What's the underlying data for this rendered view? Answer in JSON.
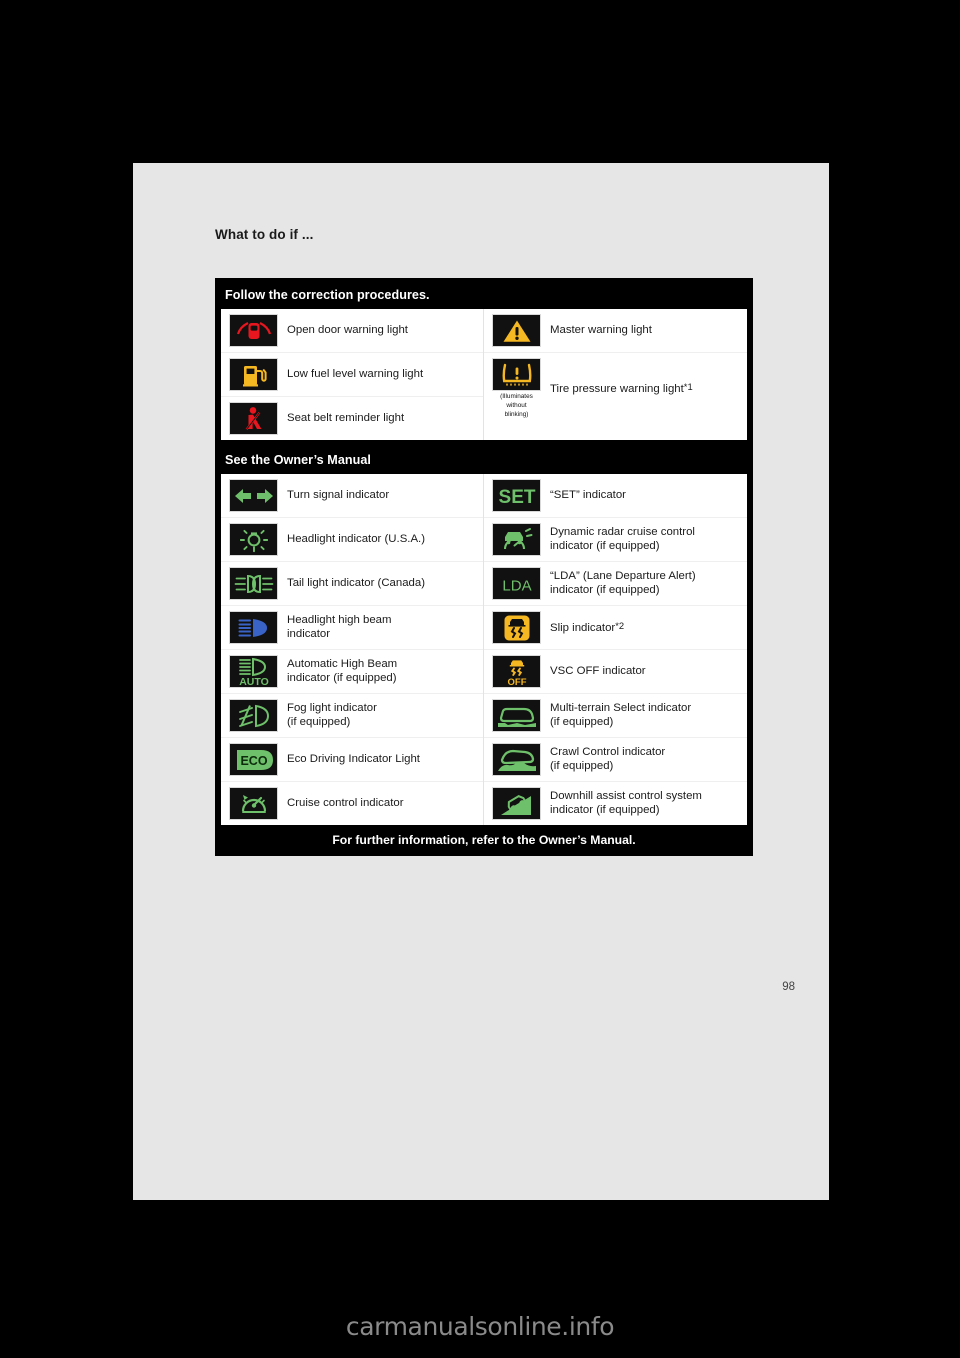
{
  "document": {
    "heading": "What to do if ...",
    "page_number": "98",
    "watermark": "carmanualsonline.info",
    "colors": {
      "page_bg": "#e6e6e6",
      "panel_bg": "#000000",
      "red": "#e8161f",
      "amber": "#f5b722",
      "green": "#6fc06a",
      "blue": "#3a63c8"
    }
  },
  "sections": [
    {
      "title": "Follow the correction procedures.",
      "left_rows": [
        {
          "icon": "open-door-warning-icon",
          "label": "Open door warning light",
          "sup": ""
        },
        {
          "icon": "low-fuel-warning-icon",
          "label": "Low fuel level warning light",
          "sup": ""
        },
        {
          "icon": "seat-belt-reminder-icon",
          "label": "Seat belt reminder light",
          "sup": ""
        }
      ],
      "right_rows": [
        {
          "icon": "master-warning-icon",
          "label": "Master warning light",
          "sup": "",
          "note": ""
        },
        {
          "icon": "tire-pressure-warning-icon",
          "label": "Tire pressure warning light",
          "sup": "*1",
          "note": "(Illuminates\nwithout\nblinking)"
        }
      ]
    },
    {
      "title": "See the Owner’s Manual",
      "left_rows": [
        {
          "icon": "turn-signal-icon",
          "label": "Turn signal indicator",
          "sup": ""
        },
        {
          "icon": "headlight-icon",
          "label": "Headlight indicator (U.S.A.)",
          "sup": ""
        },
        {
          "icon": "tail-light-icon",
          "label": "Tail light indicator (Canada)",
          "sup": ""
        },
        {
          "icon": "high-beam-icon",
          "label": "Headlight high beam\nindicator",
          "sup": ""
        },
        {
          "icon": "auto-high-beam-icon",
          "label": "Automatic High Beam\nindicator (if equipped)",
          "sup": ""
        },
        {
          "icon": "fog-light-icon",
          "label": "Fog light indicator\n(if equipped)",
          "sup": ""
        },
        {
          "icon": "eco-driving-icon",
          "label": "Eco Driving Indicator Light",
          "sup": ""
        },
        {
          "icon": "cruise-control-icon",
          "label": "Cruise control indicator",
          "sup": ""
        }
      ],
      "right_rows": [
        {
          "icon": "set-indicator-icon",
          "label": "“SET” indicator",
          "sup": ""
        },
        {
          "icon": "dynamic-radar-cruise-icon",
          "label": "Dynamic radar cruise control\nindicator (if equipped)",
          "sup": ""
        },
        {
          "icon": "lda-indicator-icon",
          "label": "“LDA” (Lane Departure Alert)\nindicator (if equipped)",
          "sup": ""
        },
        {
          "icon": "slip-indicator-icon",
          "label": "Slip indicator",
          "sup": "*2"
        },
        {
          "icon": "vsc-off-icon",
          "label": "VSC OFF indicator",
          "sup": ""
        },
        {
          "icon": "multi-terrain-select-icon",
          "label": "Multi-terrain Select indicator\n(if equipped)",
          "sup": ""
        },
        {
          "icon": "crawl-control-icon",
          "label": "Crawl Control indicator\n(if equipped)",
          "sup": ""
        },
        {
          "icon": "downhill-assist-icon",
          "label": "Downhill assist control system\nindicator (if equipped)",
          "sup": ""
        }
      ]
    }
  ],
  "footer": {
    "text": "For further information, refer to the Owner’s Manual."
  }
}
